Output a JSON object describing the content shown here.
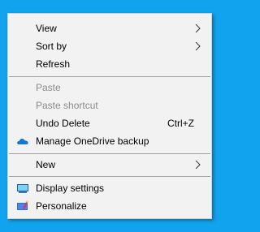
{
  "menu": {
    "view": {
      "label": "View",
      "submenu": true
    },
    "sort_by": {
      "label": "Sort by",
      "submenu": true
    },
    "refresh": {
      "label": "Refresh"
    },
    "paste": {
      "label": "Paste",
      "disabled": true
    },
    "paste_shortcut": {
      "label": "Paste shortcut",
      "disabled": true
    },
    "undo_delete": {
      "label": "Undo Delete",
      "shortcut": "Ctrl+Z"
    },
    "onedrive": {
      "label": "Manage OneDrive backup",
      "icon": "onedrive-cloud-icon"
    },
    "new": {
      "label": "New",
      "submenu": true
    },
    "display_settings": {
      "label": "Display settings",
      "icon": "display-icon"
    },
    "personalize": {
      "label": "Personalize",
      "icon": "personalize-icon"
    }
  },
  "colors": {
    "desktop_background": "#12a3ee",
    "menu_background": "#f2f2f2",
    "disabled_text": "#8b8b8b",
    "onedrive_blue": "#0f78d4"
  }
}
